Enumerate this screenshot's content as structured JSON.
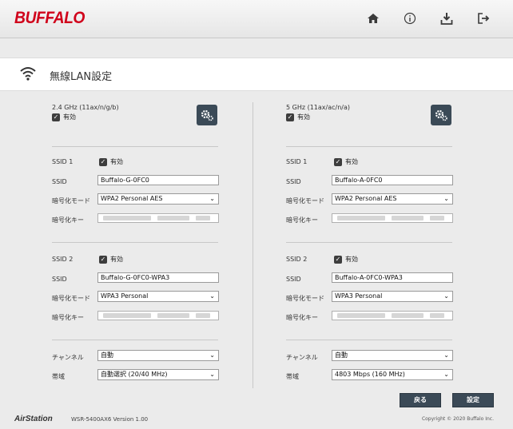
{
  "header": {
    "logo": "BUFFALO",
    "icons": [
      "home-icon",
      "info-icon",
      "download-icon",
      "logout-icon"
    ]
  },
  "page": {
    "title": "無線LAN設定"
  },
  "left": {
    "band": "2.4 GHz (11ax/n/g/b)",
    "band_enabled": "有効",
    "ssid1": {
      "label": "SSID 1",
      "enabled": "有効",
      "ssid_label": "SSID",
      "ssid_value": "Buffalo-G-0FC0",
      "enc_label": "暗号化モード",
      "enc_value": "WPA2 Personal AES",
      "key_label": "暗号化キー"
    },
    "ssid2": {
      "label": "SSID 2",
      "enabled": "有効",
      "ssid_label": "SSID",
      "ssid_value": "Buffalo-G-0FC0-WPA3",
      "enc_label": "暗号化モード",
      "enc_value": "WPA3 Personal",
      "key_label": "暗号化キー"
    },
    "channel_label": "チャンネル",
    "channel_value": "自動",
    "bandwidth_label": "帯域",
    "bandwidth_value": "自動選択 (20/40 MHz)"
  },
  "right": {
    "band": "5 GHz (11ax/ac/n/a)",
    "band_enabled": "有効",
    "ssid1": {
      "label": "SSID 1",
      "enabled": "有効",
      "ssid_label": "SSID",
      "ssid_value": "Buffalo-A-0FC0",
      "enc_label": "暗号化モード",
      "enc_value": "WPA2 Personal AES",
      "key_label": "暗号化キー"
    },
    "ssid2": {
      "label": "SSID 2",
      "enabled": "有効",
      "ssid_label": "SSID",
      "ssid_value": "Buffalo-A-0FC0-WPA3",
      "enc_label": "暗号化モード",
      "enc_value": "WPA3 Personal",
      "key_label": "暗号化キー"
    },
    "channel_label": "チャンネル",
    "channel_value": "自動",
    "bandwidth_label": "帯域",
    "bandwidth_value": "4803 Mbps (160 MHz)"
  },
  "buttons": {
    "back": "戻る",
    "set": "設定"
  },
  "footer": {
    "logo": "AirStation",
    "model": "WSR-5400AX6 Version 1.00",
    "copyright": "Copyright © 2020 Buffalo Inc."
  }
}
